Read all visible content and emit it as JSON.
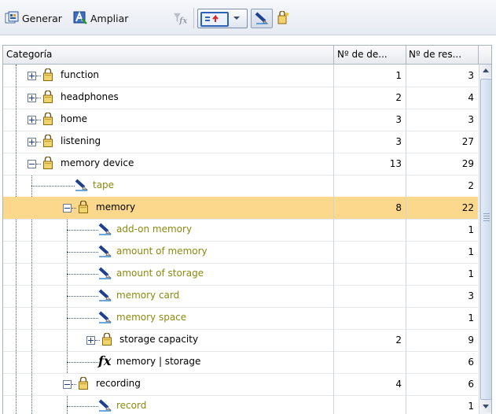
{
  "toolbar": {
    "generate_label": "Generar",
    "extend_label": "Ampliar"
  },
  "table": {
    "columns": [
      "Categoría",
      "Nº de de...",
      "Nº de res..."
    ],
    "rows": [
      {
        "label": "function",
        "type": "category",
        "depth": 1,
        "expander": "plus",
        "c1": "1",
        "c2": "3",
        "selected": false
      },
      {
        "label": "headphones",
        "type": "category",
        "depth": 1,
        "expander": "plus",
        "c1": "2",
        "c2": "4",
        "selected": false
      },
      {
        "label": "home",
        "type": "category",
        "depth": 1,
        "expander": "plus",
        "c1": "3",
        "c2": "3",
        "selected": false
      },
      {
        "label": "listening",
        "type": "category",
        "depth": 1,
        "expander": "plus",
        "c1": "3",
        "c2": "27",
        "selected": false
      },
      {
        "label": "memory device",
        "type": "category",
        "depth": 1,
        "expander": "minus",
        "c1": "13",
        "c2": "29",
        "selected": false
      },
      {
        "label": "tape",
        "type": "term",
        "depth": 2,
        "expander": "",
        "c1": "",
        "c2": "2",
        "selected": false
      },
      {
        "label": "memory",
        "type": "category",
        "depth": 2,
        "expander": "minus",
        "c1": "8",
        "c2": "22",
        "selected": true
      },
      {
        "label": "add-on memory",
        "type": "term",
        "depth": 3,
        "expander": "",
        "c1": "",
        "c2": "1",
        "selected": false
      },
      {
        "label": "amount of memory",
        "type": "term",
        "depth": 3,
        "expander": "",
        "c1": "",
        "c2": "1",
        "selected": false
      },
      {
        "label": "amount of storage",
        "type": "term",
        "depth": 3,
        "expander": "",
        "c1": "",
        "c2": "1",
        "selected": false
      },
      {
        "label": "memory card",
        "type": "term",
        "depth": 3,
        "expander": "",
        "c1": "",
        "c2": "3",
        "selected": false
      },
      {
        "label": "memory space",
        "type": "term",
        "depth": 3,
        "expander": "",
        "c1": "",
        "c2": "1",
        "selected": false
      },
      {
        "label": "storage capacity",
        "type": "category",
        "depth": 3,
        "expander": "plus",
        "c1": "2",
        "c2": "9",
        "selected": false
      },
      {
        "label": "memory | storage",
        "type": "rule",
        "depth": 3,
        "expander": "",
        "c1": "",
        "c2": "6",
        "selected": false
      },
      {
        "label": "recording",
        "type": "category",
        "depth": 2,
        "expander": "minus",
        "c1": "4",
        "c2": "6",
        "selected": false
      },
      {
        "label": "record",
        "type": "term",
        "depth": 3,
        "expander": "",
        "c1": "",
        "c2": "1",
        "selected": false
      }
    ]
  },
  "icons": [
    "generate-icon",
    "extend-icon",
    "filter-fx-icon",
    "display-dropdown-icon",
    "pen-icon",
    "category-icon",
    "rule-fx-icon"
  ],
  "colors": {
    "selected_row": "#fbd88c",
    "term_text": "#8a8a10",
    "toolbar_bg": "#e6ebf2"
  }
}
